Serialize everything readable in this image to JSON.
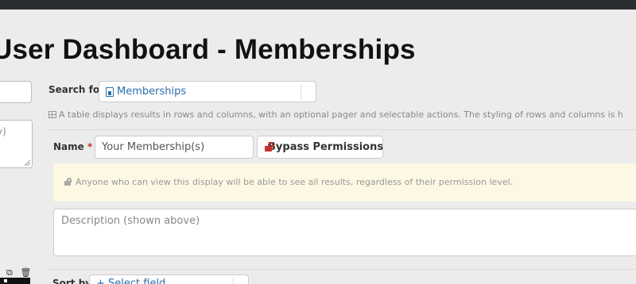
{
  "page": {
    "title": "User Dashboard - Memberships"
  },
  "left_panel": {
    "textarea_placeholder": "y)",
    "action_icons": [
      "copy-icon",
      "trash-icon"
    ]
  },
  "search": {
    "label": "Search for",
    "value": "Memberships",
    "icon": "table-icon"
  },
  "table_description": "A table displays results in rows and columns, with an optional pager and selectable actions. The styling of rows and columns is h",
  "name_field": {
    "label": "Name",
    "required_marker": "*",
    "value": "Your Membership(s)"
  },
  "bypass_button": {
    "label": "Bypass Permissions",
    "icon": "unlock-icon",
    "icon_color": "#c9302c"
  },
  "warning": {
    "text": "Anyone who can view this display will be able to see all results, regardless of their permission level.",
    "background": "#fcf8e3"
  },
  "description_field": {
    "placeholder": "Description (shown above)"
  },
  "sort": {
    "label": "Sort by",
    "value": "+ Select field"
  },
  "colors": {
    "link": "#2a6fad",
    "topbar": "#2b2e31",
    "background": "#ececec"
  }
}
